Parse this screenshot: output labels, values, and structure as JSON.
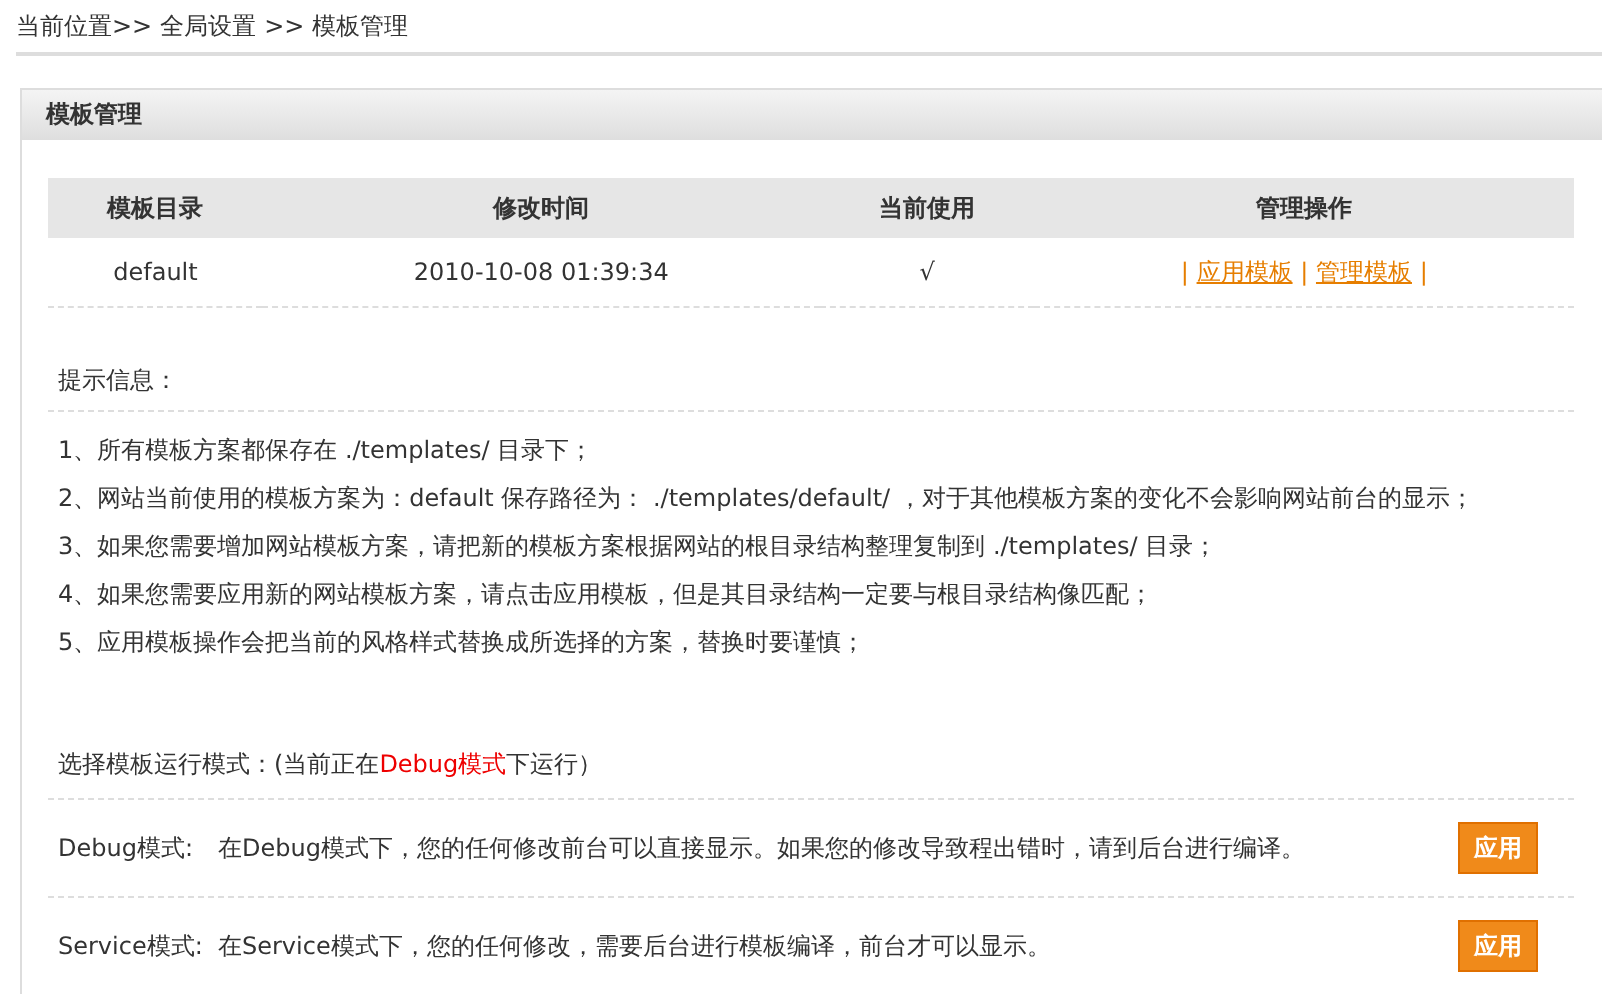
{
  "breadcrumb": [
    "当前位置>>",
    "全局设置",
    ">>",
    "模板管理"
  ],
  "panel": {
    "title": "模板管理"
  },
  "table": {
    "columns": [
      "模板目录",
      "修改时间",
      "当前使用",
      "管理操作"
    ],
    "rows": [
      {
        "directory": "default",
        "modified": "2010-10-08 01:39:34",
        "in_use": "√",
        "actions": [
          "应用模板",
          "管理模板"
        ],
        "separator": "|"
      }
    ]
  },
  "tips": {
    "title": "提示信息：",
    "items": [
      "1、所有模板方案都保存在 ./templates/ 目录下；",
      "2、网站当前使用的模板方案为：default 保存路径为： ./templates/default/ ，对于其他模板方案的变化不会影响网站前台的显示；",
      "3、如果您需要增加网站模板方案，请把新的模板方案根据网站的根目录结构整理复制到 ./templates/ 目录；",
      "4、如果您需要应用新的网站模板方案，请点击应用模板，但是其目录结构一定要与根目录结构像匹配；",
      "5、应用模板操作会把当前的风格样式替换成所选择的方案，替换时要谨慎；"
    ]
  },
  "mode_prompt": {
    "before": "选择模板运行模式：(当前正在",
    "current": "Debug模式",
    "after": "下运行）"
  },
  "modes": [
    {
      "label": "Debug模式:",
      "description": "在Debug模式下，您的任何修改前台可以直接显示。如果您的修改导致程出错时，请到后台进行编译。",
      "button": "应用"
    },
    {
      "label": "Service模式:",
      "description": "在Service模式下，您的任何修改，需要后台进行模板编译，前台才可以显示。",
      "button": "应用"
    }
  ]
}
